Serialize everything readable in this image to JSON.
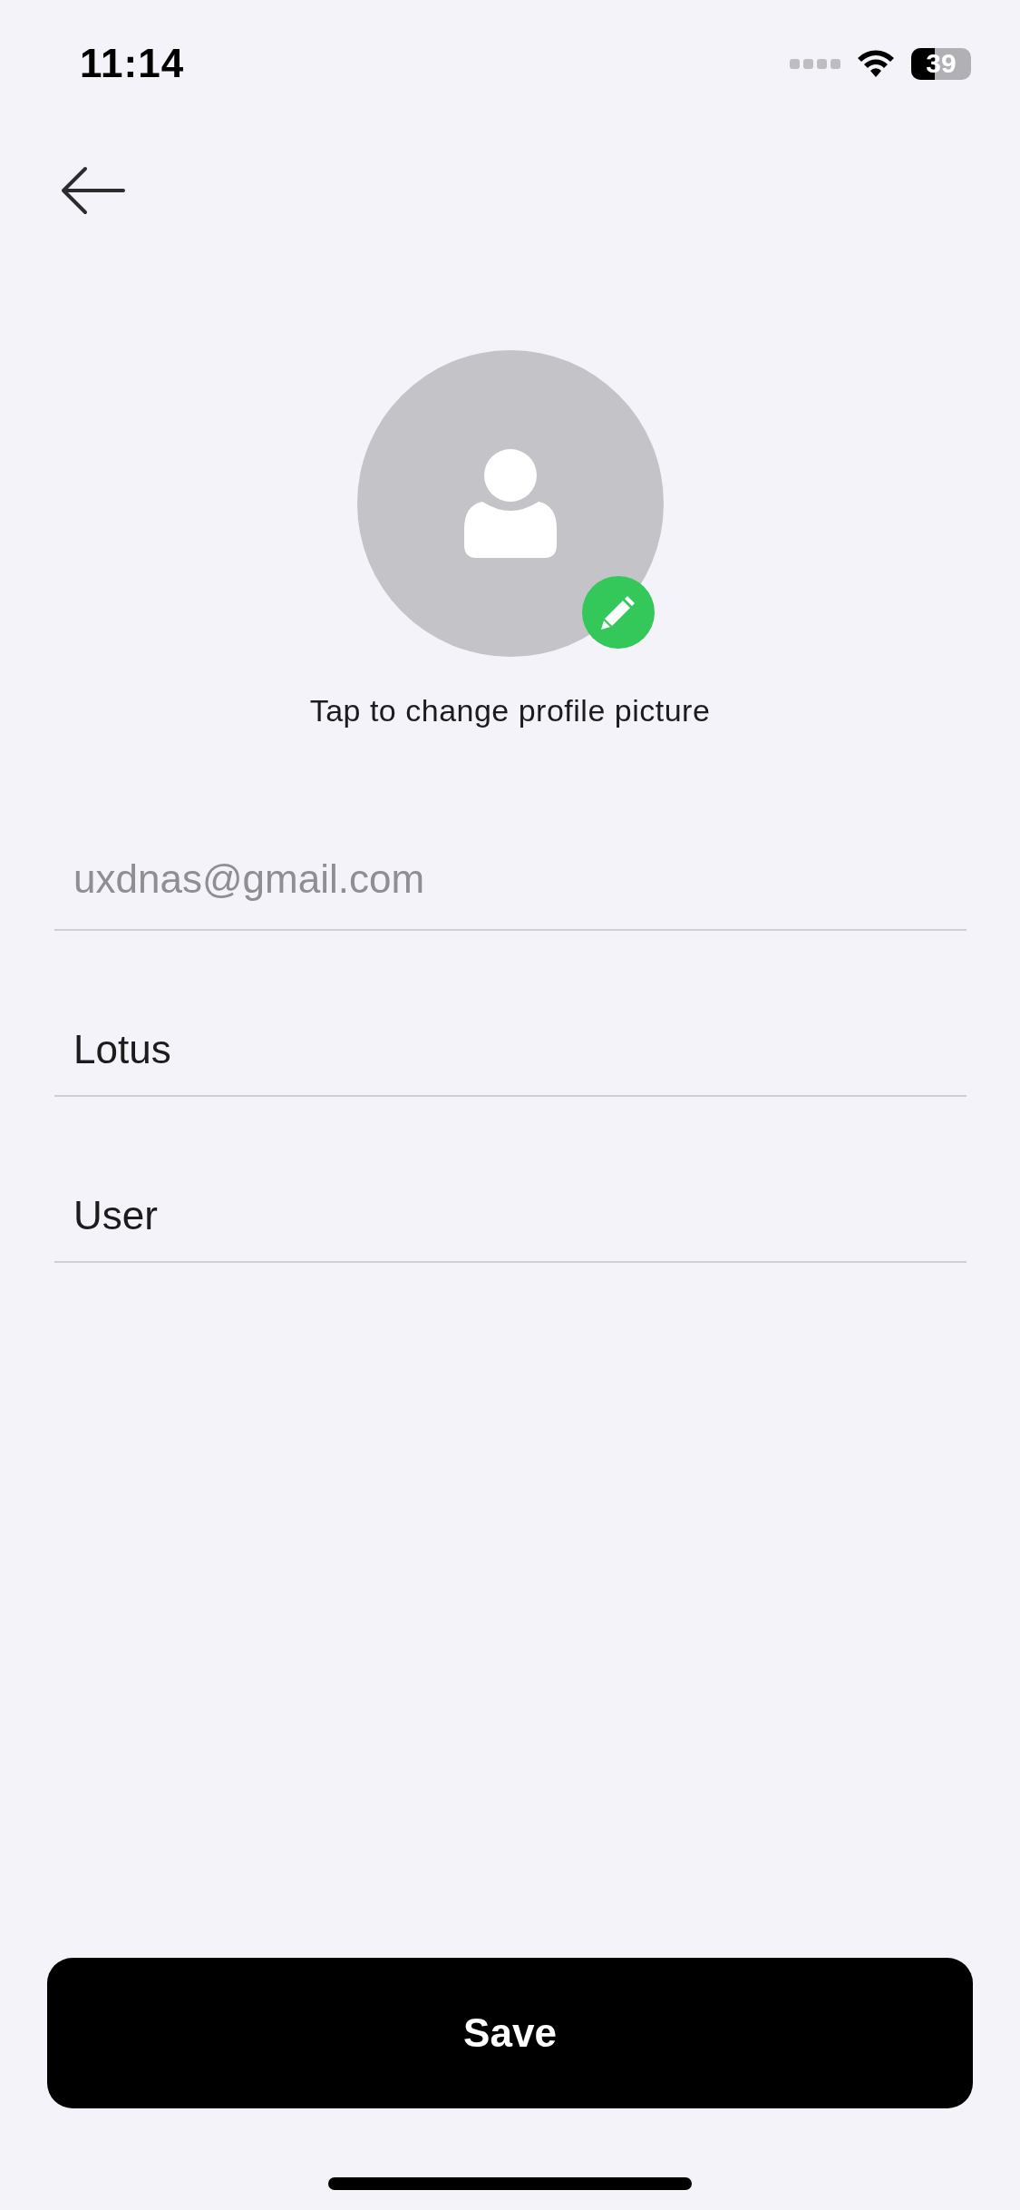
{
  "status_bar": {
    "time": "11:14",
    "battery": "39"
  },
  "avatar": {
    "caption": "Tap to change profile picture"
  },
  "fields": [
    {
      "placeholder": "uxdnas@gmail.com"
    },
    {
      "value": "Lotus"
    },
    {
      "value": "User"
    }
  ],
  "save_button": {
    "label": "Save"
  }
}
